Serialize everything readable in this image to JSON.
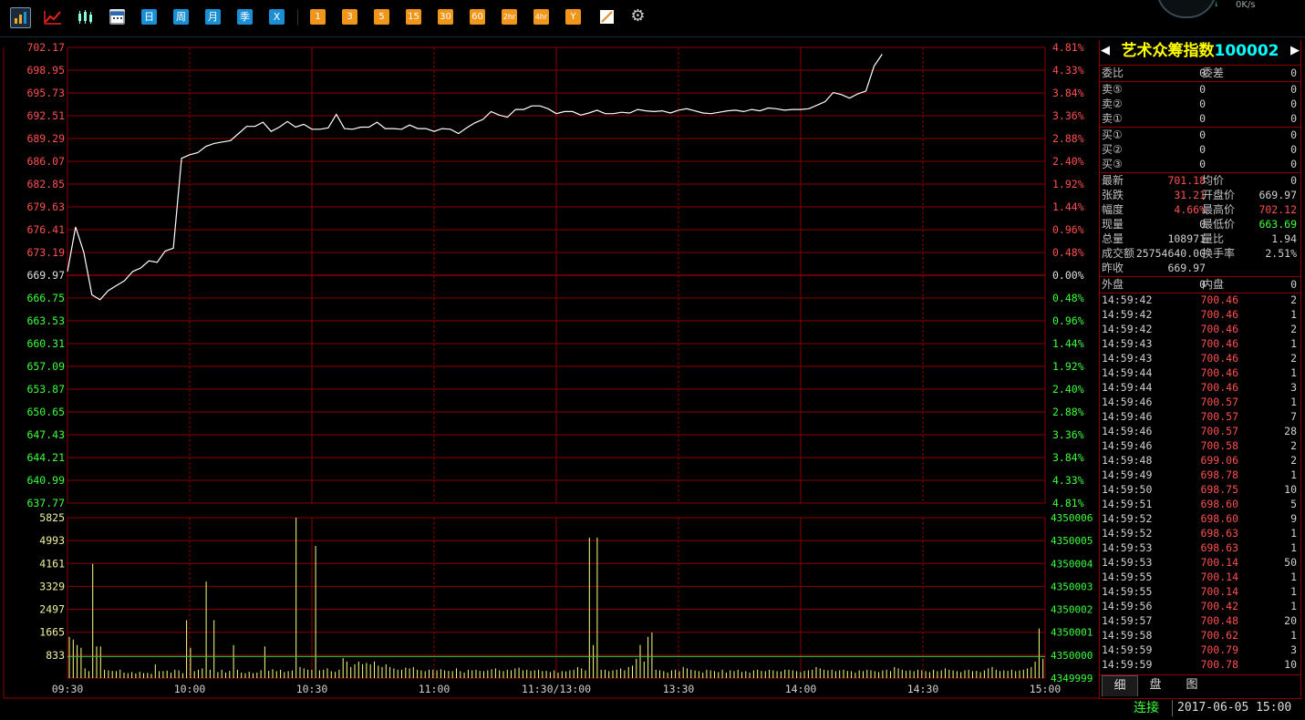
{
  "toolbar": {
    "icons": [
      "bar-chart-icon",
      "line-chart-icon",
      "candlestick-icon",
      "calendar-icon"
    ],
    "period_buttons": [
      "日",
      "周",
      "月",
      "季",
      "X"
    ],
    "minute_buttons": [
      "1",
      "3",
      "5",
      "15",
      "30",
      "60",
      "2hr",
      "4hr",
      "Y"
    ],
    "tool_icons": [
      "draw-line-icon",
      "gear-icon"
    ],
    "speed": "0K/s"
  },
  "quote": {
    "name": "艺术众筹指数",
    "code": "100002",
    "weibi_label": "委比",
    "weibi": "0",
    "weicha_label": "委差",
    "weicha": "0",
    "sell": [
      {
        "label": "卖⑤",
        "price": "0",
        "vol": "0"
      },
      {
        "label": "卖②",
        "price": "0",
        "vol": "0"
      },
      {
        "label": "卖①",
        "price": "0",
        "vol": "0"
      }
    ],
    "buy": [
      {
        "label": "买①",
        "price": "0",
        "vol": "0"
      },
      {
        "label": "买②",
        "price": "0",
        "vol": "0"
      },
      {
        "label": "买③",
        "price": "0",
        "vol": "0"
      }
    ],
    "stats": [
      {
        "l1": "最新",
        "v1": "701.18",
        "c1": "r",
        "l2": "均价",
        "v2": "0",
        "c2": "w"
      },
      {
        "l1": "张跌",
        "v1": "31.21",
        "c1": "r",
        "l2": "开盘价",
        "v2": "669.97",
        "c2": "w"
      },
      {
        "l1": "幅度",
        "v1": "4.66%",
        "c1": "r",
        "l2": "最高价",
        "v2": "702.12",
        "c2": "r"
      },
      {
        "l1": "现量",
        "v1": "0",
        "c1": "w",
        "l2": "最低价",
        "v2": "663.69",
        "c2": "g"
      },
      {
        "l1": "总量",
        "v1": "108971",
        "c1": "w",
        "l2": "量比",
        "v2": "1.94",
        "c2": "w"
      },
      {
        "l1": "成交额",
        "v1": "25754640.00",
        "c1": "w",
        "l2": "换手率",
        "v2": "2.51%",
        "c2": "w"
      },
      {
        "l1": "昨收",
        "v1": "669.97",
        "c1": "w",
        "l2": "",
        "v2": "",
        "c2": "w"
      }
    ],
    "waipan_label": "外盘",
    "waipan": "0",
    "neipan_label": "内盘",
    "neipan": "0"
  },
  "ticks": [
    [
      "14:59:42",
      "700.46",
      "2"
    ],
    [
      "14:59:42",
      "700.46",
      "1"
    ],
    [
      "14:59:42",
      "700.46",
      "2"
    ],
    [
      "14:59:43",
      "700.46",
      "1"
    ],
    [
      "14:59:43",
      "700.46",
      "2"
    ],
    [
      "14:59:44",
      "700.46",
      "1"
    ],
    [
      "14:59:44",
      "700.46",
      "3"
    ],
    [
      "14:59:46",
      "700.57",
      "1"
    ],
    [
      "14:59:46",
      "700.57",
      "7"
    ],
    [
      "14:59:46",
      "700.57",
      "28"
    ],
    [
      "14:59:46",
      "700.58",
      "2"
    ],
    [
      "14:59:48",
      "699.06",
      "2"
    ],
    [
      "14:59:49",
      "698.78",
      "1"
    ],
    [
      "14:59:50",
      "698.75",
      "10"
    ],
    [
      "14:59:51",
      "698.60",
      "5"
    ],
    [
      "14:59:52",
      "698.60",
      "9"
    ],
    [
      "14:59:52",
      "698.63",
      "1"
    ],
    [
      "14:59:53",
      "698.63",
      "1"
    ],
    [
      "14:59:53",
      "700.14",
      "50"
    ],
    [
      "14:59:55",
      "700.14",
      "1"
    ],
    [
      "14:59:55",
      "700.14",
      "1"
    ],
    [
      "14:59:56",
      "700.42",
      "1"
    ],
    [
      "14:59:57",
      "700.48",
      "20"
    ],
    [
      "14:59:58",
      "700.62",
      "1"
    ],
    [
      "14:59:59",
      "700.79",
      "3"
    ],
    [
      "14:59:59",
      "700.78",
      "10"
    ]
  ],
  "tabs": [
    "细",
    "盘",
    "图"
  ],
  "status": {
    "conn": "连接",
    "datetime": "2017-06-05 15:00"
  },
  "colors": {
    "up": "#ff4f4f",
    "down": "#3dff3d",
    "grid": "#8b0000",
    "line": "#ffffff",
    "volume": "#ffff80",
    "title": "#ffff00",
    "code": "#00ffff"
  },
  "chart_data": [
    {
      "type": "line",
      "price_ticks": [
        "702.17",
        "698.95",
        "695.73",
        "692.51",
        "689.29",
        "686.07",
        "682.85",
        "679.63",
        "676.41",
        "673.19",
        "669.97",
        "666.75",
        "663.53",
        "660.31",
        "657.09",
        "653.87",
        "650.65",
        "647.43",
        "644.21",
        "640.99",
        "637.77"
      ],
      "pct_ticks": [
        "4.81%",
        "4.33%",
        "3.84%",
        "3.36%",
        "2.88%",
        "2.40%",
        "1.92%",
        "1.44%",
        "0.96%",
        "0.48%",
        "0.00%",
        "0.48%",
        "0.96%",
        "1.44%",
        "1.92%",
        "2.40%",
        "2.88%",
        "3.36%",
        "3.84%",
        "4.33%",
        "4.81%"
      ],
      "ylim": [
        637.77,
        702.17
      ],
      "prev_close": 669.97,
      "x_labels": [
        "09:30",
        "10:00",
        "10:30",
        "11:00",
        "11:30/13:00",
        "13:30",
        "14:00",
        "14:30",
        "15:00"
      ],
      "x": [
        0,
        2,
        4,
        6,
        8,
        10,
        12,
        14,
        16,
        18,
        20,
        22,
        24,
        26,
        28,
        30,
        32,
        34,
        36,
        38,
        40,
        42,
        44,
        46,
        48,
        50,
        52,
        54,
        56,
        58,
        60,
        62,
        64,
        66,
        68,
        70,
        72,
        74,
        76,
        78,
        80,
        82,
        84,
        86,
        88,
        90,
        92,
        94,
        96,
        98,
        100,
        102,
        104,
        106,
        108,
        110,
        112,
        114,
        116,
        118,
        120,
        122,
        124,
        126,
        128,
        130,
        132,
        134,
        136,
        138,
        140,
        142,
        144,
        146,
        148,
        150,
        152,
        154,
        156,
        158,
        160,
        162,
        164,
        166,
        168,
        170,
        172,
        174,
        176,
        178,
        180,
        182,
        184,
        186,
        188,
        190,
        192,
        194,
        196,
        198,
        200,
        202,
        204,
        206,
        208,
        210,
        212,
        214,
        216,
        218,
        220,
        222,
        224,
        226,
        228,
        230,
        232,
        234,
        236,
        238,
        240
      ],
      "values": [
        670.5,
        676.8,
        673.2,
        667.2,
        666.5,
        667.8,
        668.5,
        669.2,
        670.5,
        671.0,
        672.0,
        671.8,
        673.4,
        673.8,
        686.5,
        687.0,
        687.3,
        688.2,
        688.6,
        688.8,
        689.0,
        690.0,
        691.0,
        691.0,
        691.6,
        690.3,
        690.9,
        691.7,
        690.9,
        691.3,
        690.6,
        690.6,
        690.8,
        692.7,
        690.7,
        690.6,
        690.9,
        690.9,
        691.6,
        690.7,
        690.7,
        690.6,
        691.2,
        690.7,
        690.7,
        690.3,
        690.7,
        690.6,
        690.0,
        690.8,
        691.5,
        692.0,
        693.1,
        692.6,
        692.3,
        693.4,
        693.4,
        693.9,
        693.9,
        693.5,
        692.8,
        693.1,
        693.1,
        692.6,
        692.9,
        693.3,
        692.8,
        692.8,
        693.0,
        692.9,
        693.4,
        693.2,
        693.1,
        693.2,
        692.9,
        693.3,
        693.5,
        693.2,
        692.9,
        692.8,
        693.0,
        693.2,
        693.3,
        693.1,
        693.4,
        693.2,
        693.6,
        693.5,
        693.3,
        693.4,
        693.4,
        693.5,
        694.0,
        694.5,
        695.8,
        695.5,
        695.0,
        695.6,
        696.0,
        699.5,
        701.2
      ],
      "ylabel": "",
      "xlabel": ""
    },
    {
      "type": "bar",
      "vol_ticks": [
        "5825",
        "4993",
        "4161",
        "3329",
        "2497",
        "1665",
        "833"
      ],
      "right_ticks": [
        "4350006",
        "4350005",
        "4350004",
        "4350003",
        "4350002",
        "4350001",
        "4350000",
        "4349999"
      ],
      "ylim": [
        0,
        5825
      ],
      "x_labels": [
        "09:30",
        "10:00",
        "10:30",
        "11:00",
        "11:30/13:00",
        "13:30",
        "14:00",
        "14:30",
        "15:00"
      ],
      "values": [
        1500,
        1400,
        1200,
        1100,
        350,
        250,
        4150,
        1150,
        1150,
        300,
        280,
        260,
        250,
        300,
        200,
        180,
        220,
        170,
        230,
        180,
        190,
        160,
        500,
        250,
        250,
        270,
        200,
        300,
        280,
        180,
        2100,
        1100,
        250,
        300,
        350,
        3500,
        300,
        2100,
        220,
        300,
        200,
        260,
        1200,
        300,
        200,
        180,
        230,
        180,
        200,
        280,
        1150,
        260,
        320,
        250,
        300,
        220,
        250,
        280,
        5825,
        400,
        350,
        300,
        300,
        4800,
        280,
        300,
        350,
        250,
        230,
        300,
        720,
        600,
        400,
        500,
        600,
        500,
        550,
        500,
        600,
        450,
        400,
        500,
        400,
        350,
        300,
        300,
        380,
        350,
        400,
        300,
        280,
        250,
        300,
        300,
        280,
        320,
        280,
        260,
        250,
        350,
        250,
        200,
        300,
        280,
        300,
        260,
        250,
        280,
        320,
        350,
        280,
        250,
        300,
        280,
        350,
        380,
        280,
        300,
        260,
        280,
        300,
        250,
        260,
        220,
        280,
        200,
        250,
        240,
        280,
        300,
        400,
        350,
        280,
        5100,
        1200,
        5100,
        300,
        300,
        250,
        280,
        300,
        350,
        280,
        400,
        450,
        700,
        1200,
        600,
        1500,
        1650,
        300,
        280,
        250,
        200,
        280,
        300,
        250,
        400,
        350,
        300,
        280,
        250,
        200,
        300,
        280,
        250,
        220,
        300,
        200,
        280,
        250,
        300,
        220,
        250,
        200,
        280,
        300,
        260,
        250,
        300,
        280,
        250,
        240,
        300,
        300,
        280,
        250,
        220,
        260,
        280,
        300,
        400,
        350,
        300,
        280,
        300,
        250,
        280,
        300,
        260,
        250,
        200,
        280,
        250,
        300,
        280,
        250,
        220,
        280,
        300,
        250,
        400,
        350,
        300,
        260,
        280,
        250,
        300,
        280,
        250,
        220,
        300,
        250,
        280,
        350,
        300,
        280,
        250,
        220,
        280,
        300,
        250,
        260,
        220,
        280,
        350,
        400,
        300,
        250,
        280,
        260,
        300,
        250,
        280,
        300,
        350,
        400,
        600,
        1800,
        700
      ],
      "ylabel": "",
      "xlabel": ""
    }
  ]
}
